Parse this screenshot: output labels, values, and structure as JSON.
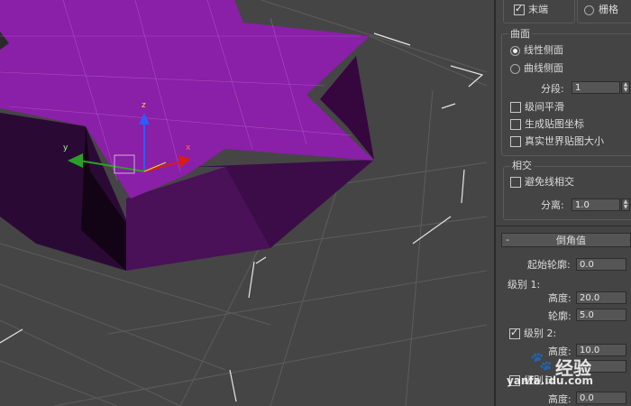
{
  "top_options": {
    "end_label": "末端",
    "grid_label": "栅格"
  },
  "surface": {
    "title": "曲面",
    "linear_sides": "线性侧面",
    "curved_sides": "曲线侧面",
    "segments_label": "分段:",
    "segments_value": "1",
    "smooth_across_levels": "级间平滑",
    "generate_mapping_coords": "生成贴图坐标",
    "real_world_map_size": "真实世界贴图大小"
  },
  "intersections": {
    "title": "相交",
    "avoid_line_intersections": "避免线相交",
    "separation_label": "分离:",
    "separation_value": "1.0"
  },
  "bevel_values": {
    "title": "倒角值",
    "collapse_symbol": "-",
    "start_outline_label": "起始轮廓:",
    "start_outline_value": "0.0",
    "level1_label": "级别 1:",
    "level1_height_label": "高度:",
    "level1_height_value": "20.0",
    "level1_outline_label": "轮廓:",
    "level1_outline_value": "5.0",
    "level2_label": "级别 2:",
    "level2_height_label": "高度:",
    "level2_height_value": "10.0",
    "level3_label": "级别 3:",
    "level3_height_label": "高度:",
    "level3_height_value": "0.0"
  },
  "viewport": {
    "gizmo_labels": {
      "z": "z",
      "x": "x",
      "y": "y"
    },
    "object_color": "#8a1fa8"
  },
  "watermark": {
    "brand": "经验",
    "url": "yanfa.idu.com"
  },
  "icons": [
    "checkmark-icon",
    "radio-icon",
    "spinner-icon",
    "move-gizmo-icon",
    "paw-icon"
  ]
}
